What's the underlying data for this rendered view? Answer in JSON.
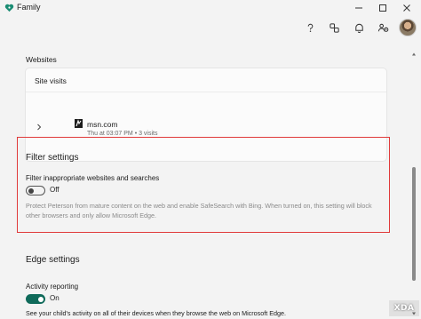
{
  "window": {
    "title": "Family",
    "controls": [
      "minimize-icon",
      "maximize-icon",
      "close-icon"
    ]
  },
  "toolbar": {
    "icons": [
      "help-icon",
      "connect-icon",
      "notification-bell-icon",
      "family-settings-icon",
      "avatar"
    ]
  },
  "websites": {
    "section_label": "Websites",
    "card_title": "Site visits",
    "items": [
      {
        "name": "msn.com",
        "meta": "Thu at 03:07 PM • 3 visits",
        "icon": "msn-favicon"
      }
    ]
  },
  "filter_settings": {
    "heading": "Filter settings",
    "option_label": "Filter inappropriate websites and searches",
    "toggle_state": "Off",
    "toggle_on": false,
    "description": "Protect Peterson from mature content on the web and enable SafeSearch with Bing. When turned on, this setting will block other browsers and only allow Microsoft Edge.",
    "highlight_color": "#e03a3a"
  },
  "edge_settings": {
    "heading": "Edge settings",
    "activity_label": "Activity reporting",
    "toggle_state": "On",
    "toggle_on": true,
    "description": "See your child's activity on all of their devices when they browse the web on Microsoft Edge.",
    "accent_color": "#0f6a5a"
  },
  "watermark": {
    "text": "XDA"
  }
}
